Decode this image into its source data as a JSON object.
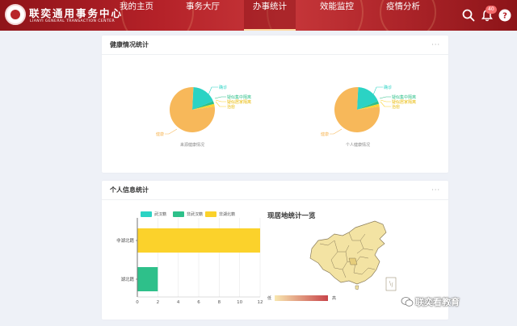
{
  "colors": {
    "header": "#b42128",
    "teal": "#2bd3c4",
    "green": "#2ec08a",
    "yellow": "#fbd22b",
    "pie_orange": "#f7b85a",
    "map_low": "#f8e7b0",
    "map_high": "#c8454a"
  },
  "header": {
    "brand_cn": "联奕通用事务中心",
    "brand_en": "LIANYI GENERAL TRANSACTION CENTER",
    "nav": [
      {
        "label": "我的主页"
      },
      {
        "label": "事务大厅"
      },
      {
        "label": "办事统计"
      },
      {
        "label": "效能监控"
      },
      {
        "label": "疫情分析"
      }
    ],
    "active_tab": "办事统计",
    "notification_count": "40"
  },
  "health_card": {
    "title": "健康情况统计",
    "more": "···",
    "pie_left": {
      "caption": "来源健康情况",
      "labels": [
        "确诊",
        "疑似集中隔离",
        "疑似居家隔离",
        "治愈",
        "健康"
      ]
    },
    "pie_right": {
      "caption": "个人健康情况",
      "labels": [
        "确诊",
        "疑似集中隔离",
        "疑似居家隔离",
        "治愈",
        "健康"
      ]
    }
  },
  "info_card": {
    "title": "个人信息统计",
    "more": "···",
    "map_title": "现居地统计一览",
    "map_low_label": "低",
    "map_high_label": "高"
  },
  "chart_data": [
    {
      "type": "pie",
      "caption": "来源健康情况",
      "labels": [
        "确诊",
        "疑似集中隔离",
        "疑似居家隔离",
        "治愈",
        "健康"
      ],
      "values": [
        18,
        2,
        1,
        1,
        78
      ]
    },
    {
      "type": "pie",
      "caption": "个人健康情况",
      "labels": [
        "确诊",
        "疑似集中隔离",
        "疑似居家隔离",
        "治愈",
        "健康"
      ],
      "values": [
        18,
        2,
        1,
        1,
        78
      ]
    },
    {
      "type": "bar",
      "orientation": "horizontal",
      "categories": [
        "湖北籍",
        "非湖北籍"
      ],
      "series": [
        {
          "name": "武汉籍",
          "values": [
            0,
            0
          ]
        },
        {
          "name": "非武汉籍",
          "values": [
            2,
            0
          ]
        },
        {
          "name": "非湖北籍",
          "values": [
            0,
            12
          ]
        }
      ],
      "xticks": [
        "0",
        "2",
        "4",
        "6",
        "8",
        "10",
        "12"
      ],
      "xlim": [
        0,
        12
      ],
      "legend": "top"
    }
  ],
  "watermark": "联奕看教育"
}
